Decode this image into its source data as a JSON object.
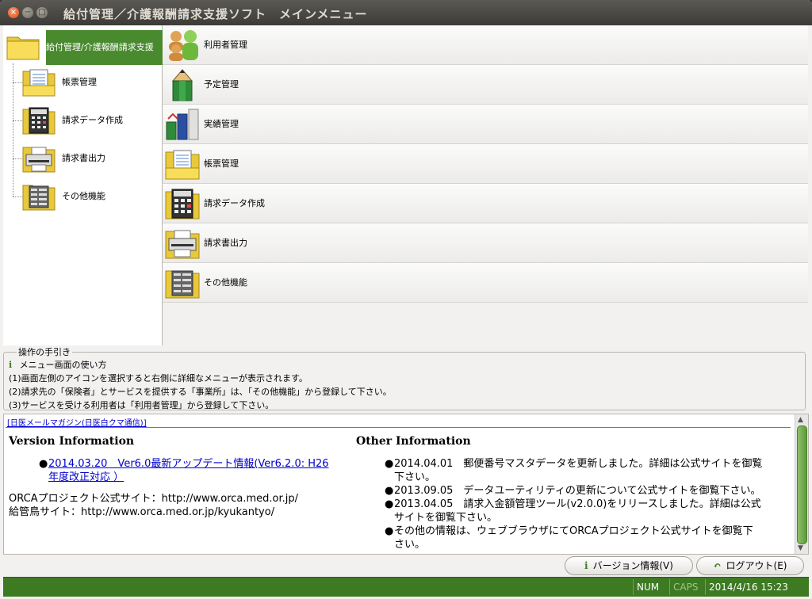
{
  "window": {
    "title": "給付管理／介護報酬請求支援ソフト　メインメニュー",
    "close_glyph": "×",
    "min_glyph": "−",
    "max_glyph": "□"
  },
  "tree": {
    "root_label": "給付管理/介護報酬請求支援",
    "items": [
      {
        "label": "帳票管理",
        "icon": "document-folder-icon"
      },
      {
        "label": "請求データ作成",
        "icon": "calculator-folder-icon"
      },
      {
        "label": "請求書出力",
        "icon": "printer-folder-icon"
      },
      {
        "label": "その他機能",
        "icon": "table-folder-icon"
      }
    ]
  },
  "menu": {
    "items": [
      {
        "label": "利用者管理",
        "icon": "users-icon"
      },
      {
        "label": "予定管理",
        "icon": "pencil-icon"
      },
      {
        "label": "実績管理",
        "icon": "bar-chart-icon"
      },
      {
        "label": "帳票管理",
        "icon": "document-folder-icon"
      },
      {
        "label": "請求データ作成",
        "icon": "calculator-folder-icon"
      },
      {
        "label": "請求書出力",
        "icon": "printer-folder-icon"
      },
      {
        "label": "その他機能",
        "icon": "table-folder-icon"
      }
    ]
  },
  "guide": {
    "legend": "操作の手引き",
    "info_glyph": "i",
    "heading": "メニュー画面の使い方",
    "lines": [
      "(1)画面左側のアイコンを選択すると右側に詳細なメニューが表示されます。",
      "(2)請求先の「保険者」とサービスを提供する「事業所」は、「その他機能」から登録して下さい。",
      "(3)サービスを受ける利用者は「利用者管理」から登録して下さい。"
    ]
  },
  "browser": {
    "magazine_link": "[日医メールマガジン(日医白クマ通信)]",
    "version_title": "Version Information",
    "version_link_line1": "2014.03.20　Ver6.0最新アップデート情報(Ver6.2.0: H26",
    "version_link_line2": "年度改正対応 ）",
    "orca_site": "ORCAプロジェクト公式サイト：http://www.orca.med.or.jp/",
    "kyukan_site": "給管鳥サイト：http://www.orca.med.or.jp/kyukantyo/",
    "other_title": "Other Information",
    "other_items": [
      {
        "l1": "2014.04.01　郵便番号マスタデータを更新しました。詳細は公式サイトを御覧",
        "l2": "下さい。"
      },
      {
        "l1": "2013.09.05　データユーティリティの更新について公式サイトを御覧下さい。",
        "l2": ""
      },
      {
        "l1": "2013.04.05　請求入金額管理ツール(v2.0.0)をリリースしました。詳細は公式",
        "l2": "サイトを御覧下さい。"
      },
      {
        "l1": "その他の情報は、ウェブブラウザにてORCAプロジェクト公式サイトを御覧下",
        "l2": "さい。"
      }
    ],
    "bullet_glyph": "●",
    "scroll_up": "▲",
    "scroll_down": "▼"
  },
  "buttons": {
    "version_glyph": "i",
    "version_label": "バージョン情報(V)",
    "logout_glyph": "↶",
    "logout_label": "ログアウト(E)"
  },
  "status": {
    "num": "NUM",
    "caps": "CAPS",
    "datetime": "2014/4/16 15:23"
  },
  "colors": {
    "accent_green": "#4a8a2f",
    "status_green": "#3d7a22",
    "link_blue": "#0000cc",
    "titlebar": "#3c3b37"
  }
}
